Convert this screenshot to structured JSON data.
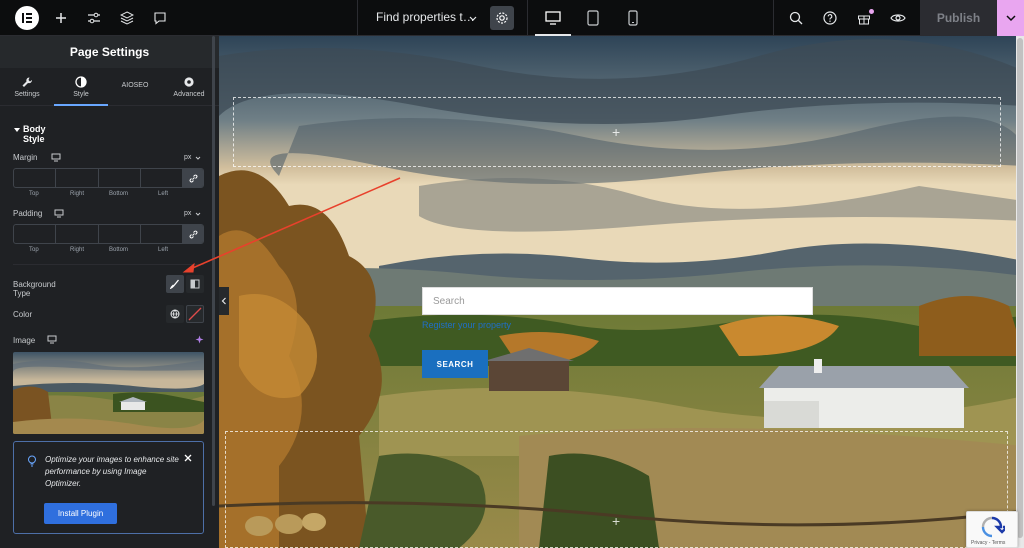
{
  "topbar": {
    "doc_title": "Find properties t…",
    "publish_label": "Publish",
    "colors": {
      "accent": "#e9a6f0",
      "bg": "#0c0d0e"
    }
  },
  "panel": {
    "title": "Page Settings",
    "tabs": [
      {
        "label": "Settings",
        "icon": "wrench-icon"
      },
      {
        "label": "Style",
        "icon": "contrast-icon"
      },
      {
        "label": "AIOSEO",
        "icon": ""
      },
      {
        "label": "Advanced",
        "icon": "gear-icon"
      }
    ],
    "section": "Body Style",
    "margin": {
      "label": "Margin",
      "unit": "px",
      "sides": [
        "Top",
        "Right",
        "Bottom",
        "Left"
      ]
    },
    "padding": {
      "label": "Padding",
      "unit": "px",
      "sides": [
        "Top",
        "Right",
        "Bottom",
        "Left"
      ]
    },
    "background_type_label": "Background Type",
    "color_label": "Color",
    "image_label": "Image",
    "promo": {
      "text": "Optimize your images to enhance site performance by using Image Optimizer.",
      "button": "Install Plugin"
    }
  },
  "canvas": {
    "search_placeholder": "Search",
    "register_link": "Register your property",
    "search_button": "SEARCH"
  }
}
